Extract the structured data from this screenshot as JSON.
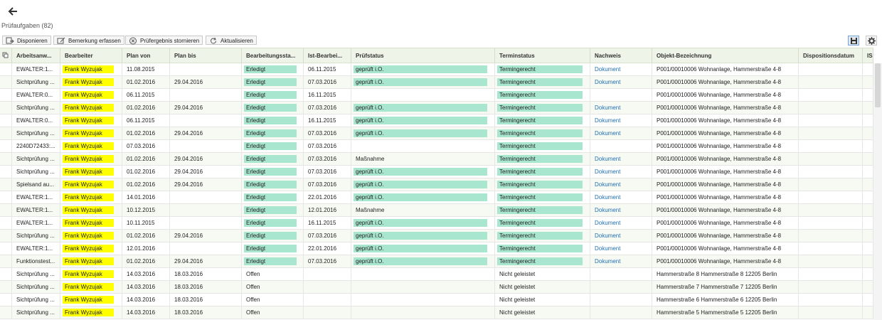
{
  "page": {
    "title": "Prüfaufgaben (82)"
  },
  "toolbar": {
    "disponieren": "Disponieren",
    "bemerkung": "Bemerkung erfassen",
    "storno": "Prüfergebnis stornieren",
    "refresh": "Aktualisieren"
  },
  "columns": [
    "Arbeitsanw...",
    "Bearbeiter",
    "Plan von",
    "Plan bis",
    "Bearbeitungssta...",
    "Ist-Bearbei...",
    "Prüfstatus",
    "Terminstatus",
    "Nachweis",
    "Objekt-Bezeichnung",
    "Dispositionsdatum",
    "IS"
  ],
  "rows": [
    [
      "EWALTER:1...",
      "Frank Wyzujak",
      "11.08.2015",
      "",
      "Erledigt",
      "06.11.2015",
      "geprüft i.O.",
      "Termingerecht",
      "Dokument",
      "P001/00010006 Wohnanlage, Hammerstraße 4-8"
    ],
    [
      "Sichtprüfung ...",
      "Frank Wyzujak",
      "01.02.2016",
      "29.04.2016",
      "Erledigt",
      "07.03.2016",
      "geprüft i.O.",
      "Termingerecht",
      "Dokument",
      "P001/00010006 Wohnanlage, Hammerstraße 4-8"
    ],
    [
      "EWALTER:0...",
      "Frank Wyzujak",
      "06.11.2015",
      "",
      "Erledigt",
      "16.11.2015",
      "",
      "Termingerecht",
      "",
      "P001/00010006 Wohnanlage, Hammerstraße 4-8"
    ],
    [
      "Sichtprüfung ...",
      "Frank Wyzujak",
      "01.02.2016",
      "29.04.2016",
      "Erledigt",
      "07.03.2016",
      "geprüft i.O.",
      "Termingerecht",
      "Dokument",
      "P001/00010006 Wohnanlage, Hammerstraße 4-8"
    ],
    [
      "EWALTER:0...",
      "Frank Wyzujak",
      "06.11.2015",
      "",
      "Erledigt",
      "16.11.2015",
      "geprüft i.O.",
      "Termingerecht",
      "Dokument",
      "P001/00010006 Wohnanlage, Hammerstraße 4-8"
    ],
    [
      "Sichtprüfung ...",
      "Frank Wyzujak",
      "01.02.2016",
      "29.04.2016",
      "Erledigt",
      "07.03.2016",
      "geprüft i.O.",
      "Termingerecht",
      "Dokument",
      "P001/00010006 Wohnanlage, Hammerstraße 4-8"
    ],
    [
      "2240D72433:...",
      "Frank Wyzujak",
      "07.03.2016",
      "",
      "Erledigt",
      "07.03.2016",
      "",
      "Termingerecht",
      "",
      "P001/00010006 Wohnanlage, Hammerstraße 4-8"
    ],
    [
      "Sichtprüfung ...",
      "Frank Wyzujak",
      "01.02.2016",
      "29.04.2016",
      "Erledigt",
      "07.03.2016",
      "Maßnahme",
      "Termingerecht",
      "Dokument",
      "P001/00010006 Wohnanlage, Hammerstraße 4-8"
    ],
    [
      "Sichtprüfung ...",
      "Frank Wyzujak",
      "01.02.2016",
      "29.04.2016",
      "Erledigt",
      "07.03.2016",
      "geprüft i.O.",
      "Termingerecht",
      "Dokument",
      "P001/00010006 Wohnanlage, Hammerstraße 4-8"
    ],
    [
      "Spielsand au...",
      "Frank Wyzujak",
      "01.02.2016",
      "29.04.2016",
      "Erledigt",
      "07.03.2016",
      "geprüft i.O.",
      "Termingerecht",
      "Dokument",
      "P001/00010006 Wohnanlage, Hammerstraße 4-8"
    ],
    [
      "EWALTER:1...",
      "Frank Wyzujak",
      "14.01.2016",
      "",
      "Erledigt",
      "22.01.2016",
      "geprüft i.O.",
      "Termingerecht",
      "Dokument",
      "P001/00010006 Wohnanlage, Hammerstraße 4-8"
    ],
    [
      "EWALTER:1...",
      "Frank Wyzujak",
      "10.12.2015",
      "",
      "Erledigt",
      "12.01.2016",
      "Maßnahme",
      "Termingerecht",
      "Dokument",
      "P001/00010006 Wohnanlage, Hammerstraße 4-8"
    ],
    [
      "EWALTER:1...",
      "Frank Wyzujak",
      "10.11.2015",
      "",
      "Erledigt",
      "16.11.2015",
      "geprüft i.O.",
      "Termingerecht",
      "Dokument",
      "P001/00010006 Wohnanlage, Hammerstraße 4-8"
    ],
    [
      "Sichtprüfung ...",
      "Frank Wyzujak",
      "01.02.2016",
      "29.04.2016",
      "Erledigt",
      "07.03.2016",
      "geprüft i.O.",
      "Termingerecht",
      "Dokument",
      "P001/00010006 Wohnanlage, Hammerstraße 4-8"
    ],
    [
      "EWALTER:1...",
      "Frank Wyzujak",
      "12.01.2016",
      "",
      "Erledigt",
      "22.01.2016",
      "geprüft i.O.",
      "Termingerecht",
      "Dokument",
      "P001/00010006 Wohnanlage, Hammerstraße 4-8"
    ],
    [
      "Funktionstest...",
      "Frank Wyzujak",
      "01.02.2016",
      "29.04.2016",
      "Erledigt",
      "07.03.2016",
      "geprüft i.O.",
      "Termingerecht",
      "Dokument",
      "P001/00010006 Wohnanlage, Hammerstraße 4-8"
    ],
    [
      "Sichtprüfung ...",
      "Frank Wyzujak",
      "14.03.2016",
      "18.03.2016",
      "Offen",
      "",
      "",
      "Nicht geleistet",
      "",
      "Hammerstraße 8 Hammerstraße 8 12205 Berlin"
    ],
    [
      "Sichtprüfung ...",
      "Frank Wyzujak",
      "14.03.2016",
      "18.03.2016",
      "Offen",
      "",
      "",
      "Nicht geleistet",
      "",
      "Hammerstraße 7 Hammerstraße 7 12205 Berlin"
    ],
    [
      "Sichtprüfung ...",
      "Frank Wyzujak",
      "14.03.2016",
      "18.03.2016",
      "Offen",
      "",
      "",
      "Nicht geleistet",
      "",
      "Hammerstraße 6 Hammerstraße 6 12205 Berlin"
    ],
    [
      "Sichtprüfung ...",
      "Frank Wyzujak",
      "14.03.2016",
      "18.03.2016",
      "Offen",
      "",
      "",
      "Nicht geleistet",
      "",
      "Hammerstraße 5 Hammerstraße 5 12205 Berlin"
    ]
  ],
  "colors": {
    "bearbeiter": "#ffff00",
    "status_fill": "#a8e6cf",
    "link": "#1f6fb2"
  }
}
